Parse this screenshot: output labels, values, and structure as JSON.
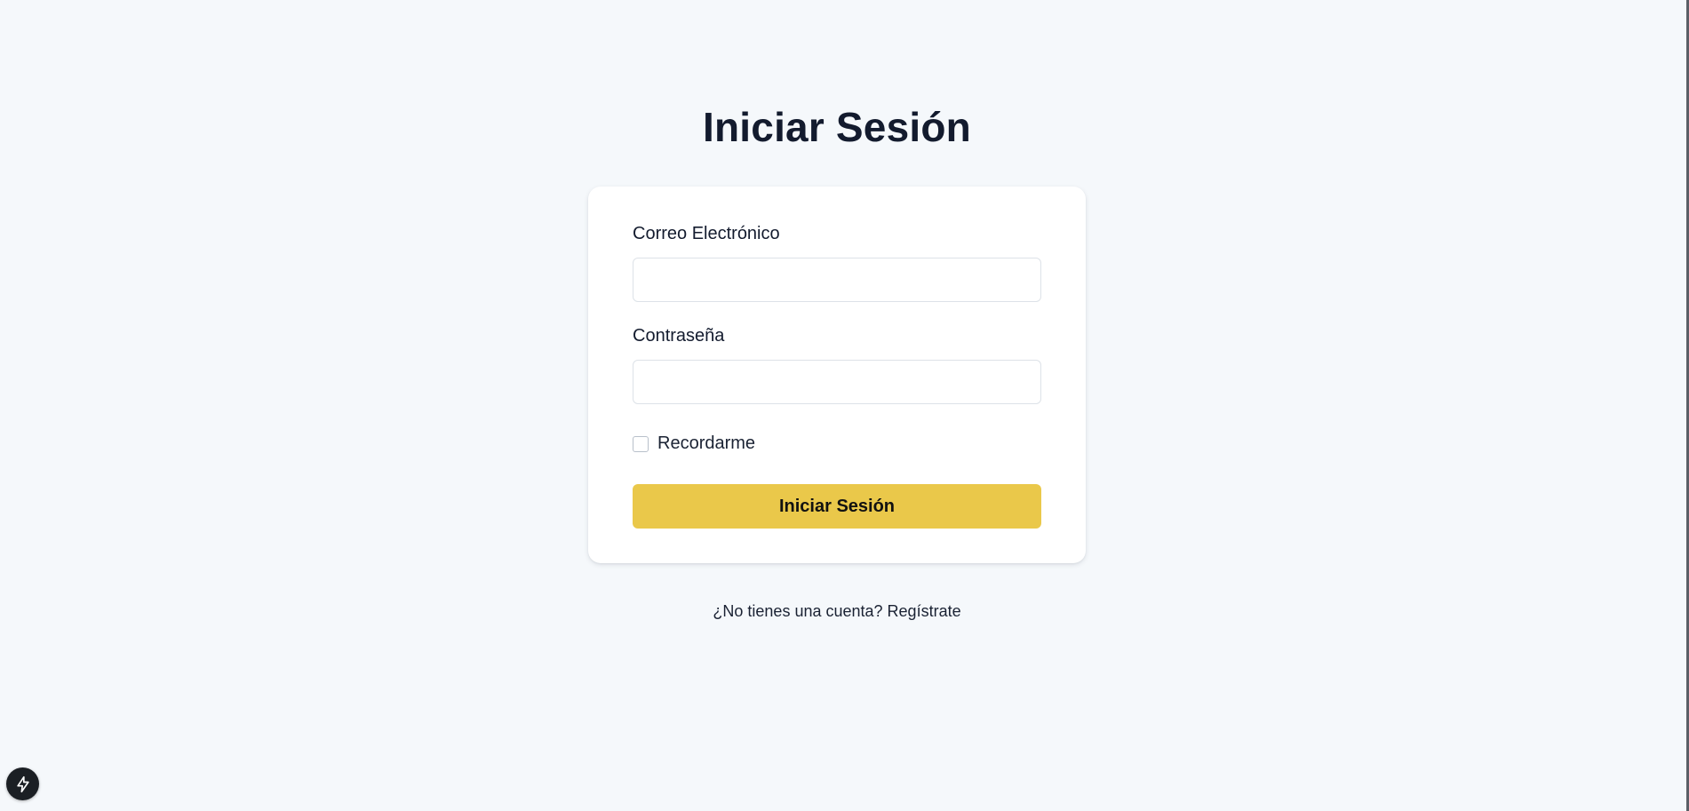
{
  "page": {
    "title": "Iniciar Sesión"
  },
  "form": {
    "email_label": "Correo Electrónico",
    "email_value": "",
    "password_label": "Contraseña",
    "password_value": "",
    "remember_label": "Recordarme",
    "remember_checked": false,
    "submit_label": "Iniciar Sesión"
  },
  "footer": {
    "prompt": "¿No tienes una cuenta? ",
    "link_label": "Regístrate"
  },
  "dev_tool": {
    "icon": "lightning-bolt-icon"
  },
  "colors": {
    "background": "#f5f8fb",
    "button": "#eac84a",
    "text": "#131b2e"
  }
}
